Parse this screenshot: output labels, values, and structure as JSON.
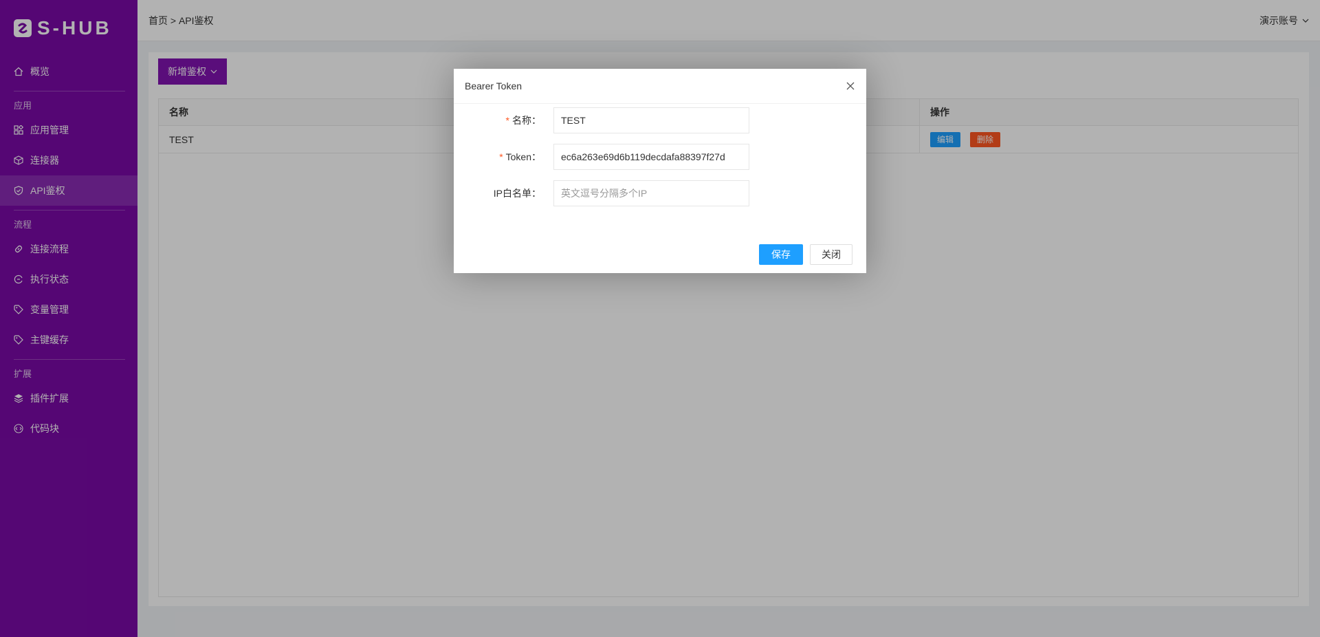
{
  "app": {
    "logo_text": "S-HUB"
  },
  "sidebar": {
    "items_top": [
      {
        "label": "概览",
        "icon": "home-icon"
      }
    ],
    "group_app": "应用",
    "items_app": [
      {
        "label": "应用管理",
        "icon": "apps-icon"
      },
      {
        "label": "连接器",
        "icon": "cube-icon"
      },
      {
        "label": "API鉴权",
        "icon": "shield-icon",
        "active": true
      }
    ],
    "group_flow": "流程",
    "items_flow": [
      {
        "label": "连接流程",
        "icon": "link-icon"
      },
      {
        "label": "执行状态",
        "icon": "status-icon"
      },
      {
        "label": "变量管理",
        "icon": "tag-icon"
      },
      {
        "label": "主键缓存",
        "icon": "tag-icon"
      }
    ],
    "group_ext": "扩展",
    "items_ext": [
      {
        "label": "插件扩展",
        "icon": "layers-icon"
      },
      {
        "label": "代码块",
        "icon": "code-icon"
      }
    ]
  },
  "header": {
    "breadcrumb": "首页 > API鉴权",
    "user": "演示账号"
  },
  "toolbar": {
    "add_label": "新增鉴权"
  },
  "table": {
    "columns": [
      "名称",
      "操作"
    ],
    "rows": [
      {
        "name": "TEST",
        "edit_label": "编辑",
        "delete_label": "删除"
      }
    ]
  },
  "modal": {
    "title": "Bearer Token",
    "fields": {
      "name": {
        "label": "名称：",
        "value": "TEST"
      },
      "token": {
        "label": "Token：",
        "value": "ec6a263e69d6b119decdafa88397f27d"
      },
      "ip": {
        "label": "IP白名单：",
        "placeholder": "英文逗号分隔多个IP"
      }
    },
    "save_label": "保存",
    "close_label": "关闭"
  },
  "colors": {
    "sidebar": "#7a0aa6",
    "primary_button": "#8213b1",
    "edit": "#1e9fff",
    "delete": "#ff5722"
  }
}
